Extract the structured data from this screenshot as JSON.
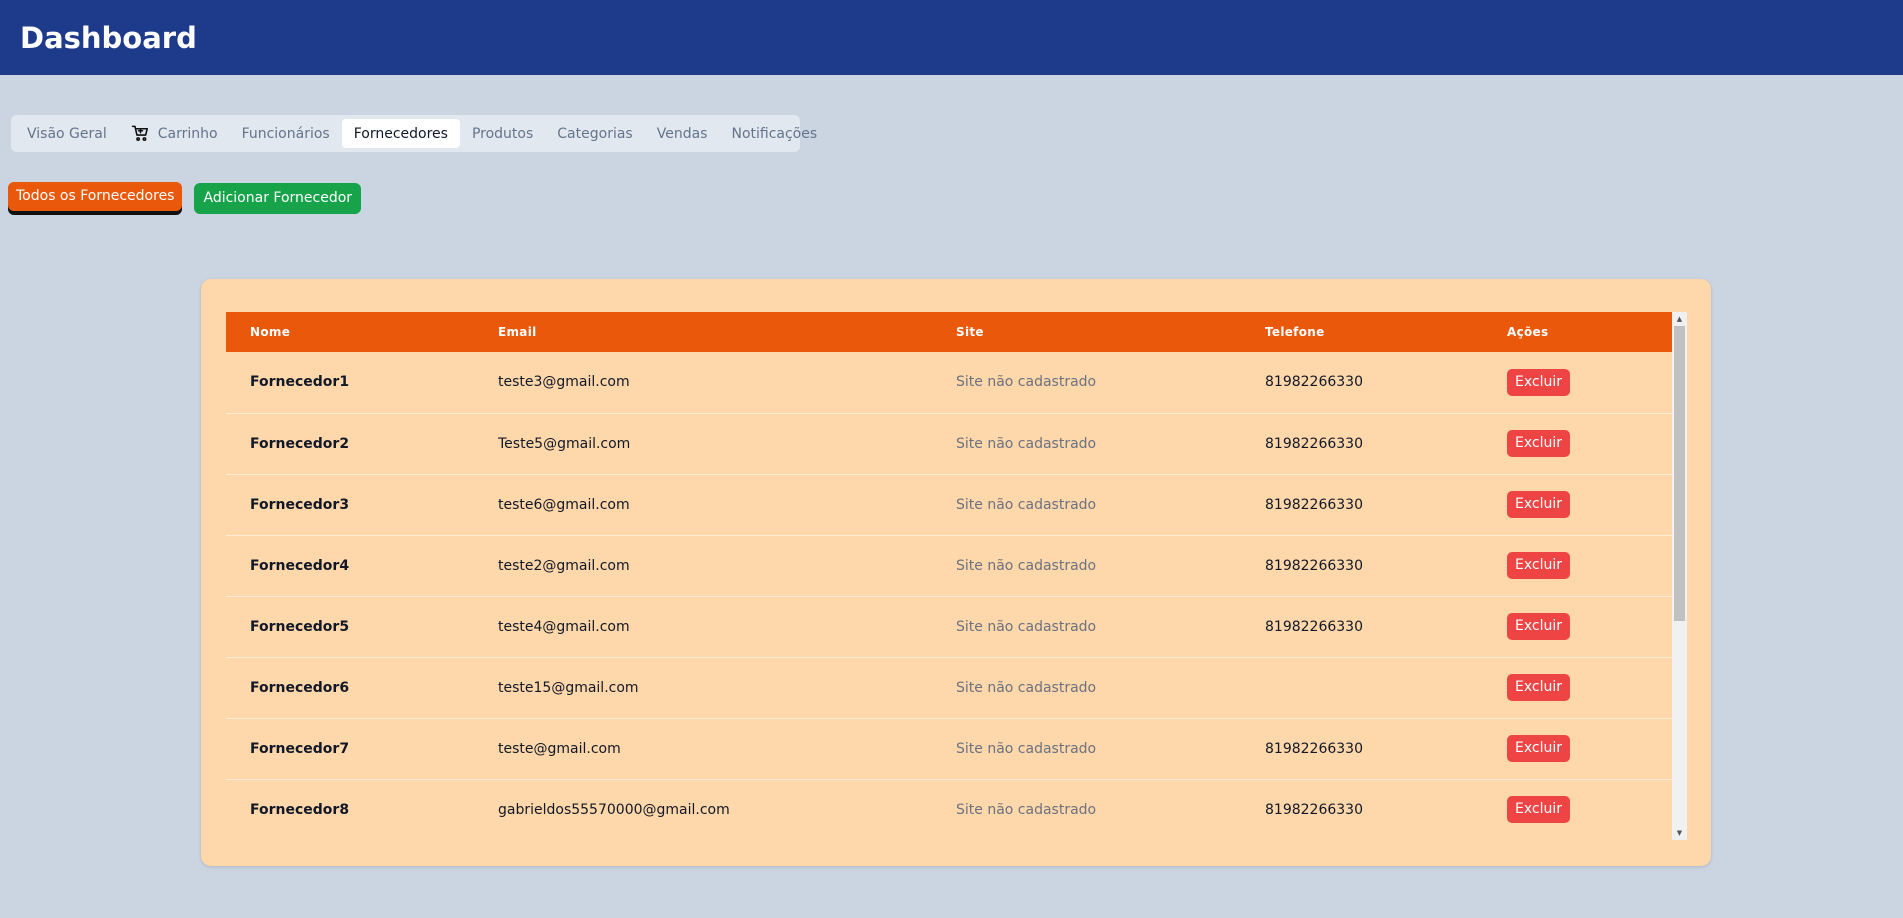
{
  "header": {
    "title": "Dashboard"
  },
  "tabs": [
    {
      "label": "Visão Geral",
      "icon": null,
      "active": false
    },
    {
      "label": "Carrinho",
      "icon": "cart-icon",
      "active": false
    },
    {
      "label": "Funcionários",
      "icon": null,
      "active": false
    },
    {
      "label": "Fornecedores",
      "icon": null,
      "active": true
    },
    {
      "label": "Produtos",
      "icon": null,
      "active": false
    },
    {
      "label": "Categorias",
      "icon": null,
      "active": false
    },
    {
      "label": "Vendas",
      "icon": null,
      "active": false
    },
    {
      "label": "Notificações",
      "icon": null,
      "active": false
    }
  ],
  "actions": {
    "all_suppliers_label": "Todos os Fornecedores",
    "add_supplier_label": "Adicionar Fornecedor"
  },
  "table": {
    "columns": [
      "Nome",
      "Email",
      "Site",
      "Telefone",
      "Ações"
    ],
    "rows": [
      {
        "name": "Fornecedor1",
        "email": "teste3@gmail.com",
        "site": "Site não cadastrado",
        "phone": "81982266330",
        "action": "Excluir"
      },
      {
        "name": "Fornecedor2",
        "email": "Teste5@gmail.com",
        "site": "Site não cadastrado",
        "phone": "81982266330",
        "action": "Excluir"
      },
      {
        "name": "Fornecedor3",
        "email": "teste6@gmail.com",
        "site": "Site não cadastrado",
        "phone": "81982266330",
        "action": "Excluir"
      },
      {
        "name": "Fornecedor4",
        "email": "teste2@gmail.com",
        "site": "Site não cadastrado",
        "phone": "81982266330",
        "action": "Excluir"
      },
      {
        "name": "Fornecedor5",
        "email": "teste4@gmail.com",
        "site": "Site não cadastrado",
        "phone": "81982266330",
        "action": "Excluir"
      },
      {
        "name": "Fornecedor6",
        "email": "teste15@gmail.com",
        "site": "Site não cadastrado",
        "phone": "",
        "action": "Excluir"
      },
      {
        "name": "Fornecedor7",
        "email": "teste@gmail.com",
        "site": "Site não cadastrado",
        "phone": "81982266330",
        "action": "Excluir"
      },
      {
        "name": "Fornecedor8",
        "email": "gabrieldos55570000@gmail.com",
        "site": "Site não cadastrado",
        "phone": "81982266330",
        "action": "Excluir"
      }
    ]
  },
  "colors": {
    "header_bg": "#1e3a8a",
    "page_bg": "#cbd5e1",
    "accent_orange": "#ea580c",
    "accent_green": "#16a34a",
    "danger_red": "#ef4444",
    "card_bg": "#fed7aa"
  }
}
